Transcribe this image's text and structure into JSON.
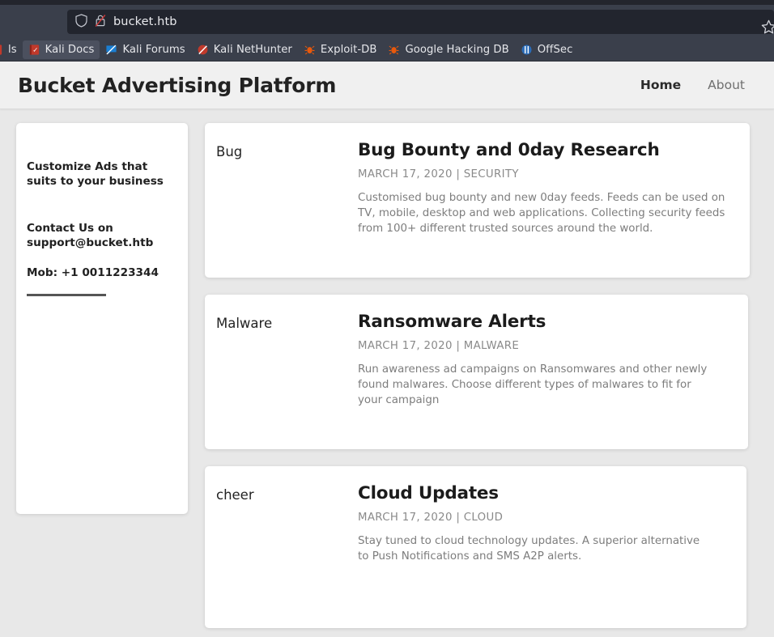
{
  "browser": {
    "url": "bucket.htb",
    "shield_icon": "shield-icon",
    "lock_icon": "lock-crossed-out-icon",
    "star_icon": "bookmark-star-icon",
    "bookmarks": [
      {
        "label": "ls",
        "icon": "kali-tools-icon",
        "active": false,
        "partial": true
      },
      {
        "label": "Kali Docs",
        "icon": "kali-docs-icon",
        "active": true
      },
      {
        "label": "Kali Forums",
        "icon": "kali-forums-icon",
        "active": false
      },
      {
        "label": "Kali NetHunter",
        "icon": "kali-nethunter-icon",
        "active": false
      },
      {
        "label": "Exploit-DB",
        "icon": "exploit-db-icon",
        "active": false
      },
      {
        "label": "Google Hacking DB",
        "icon": "google-hacking-db-icon",
        "active": false
      },
      {
        "label": "OffSec",
        "icon": "offsec-icon",
        "active": false
      }
    ]
  },
  "site": {
    "title": "Bucket Advertising Platform",
    "nav": [
      {
        "label": "Home",
        "active": true
      },
      {
        "label": "About",
        "active": false
      }
    ]
  },
  "sidebar": {
    "heading": "Customize Ads that suits to your business",
    "contact": "Contact Us on support@bucket.htb",
    "mobile": "Mob: +1 0011223344"
  },
  "posts": [
    {
      "category": "Bug",
      "title": "Bug Bounty and 0day Research",
      "meta": "MARCH 17, 2020 | SECURITY",
      "description": "Customised bug bounty and new 0day feeds. Feeds can be used on TV, mobile, desktop and web applications. Collecting security feeds from 100+ different trusted sources around the world."
    },
    {
      "category": "Malware",
      "title": "Ransomware Alerts",
      "meta": "MARCH 17, 2020 | MALWARE",
      "description": "Run awareness ad campaigns on Ransomwares and other newly found malwares. Choose different types of malwares to fit for your campaign"
    },
    {
      "category": "cheer",
      "title": "Cloud Updates",
      "meta": "MARCH 17, 2020 | CLOUD",
      "description": "Stay tuned to cloud technology updates. A superior alternative to Push Notifications and SMS A2P alerts."
    }
  ],
  "colors": {
    "chrome": "#3a3f4b",
    "urlbar": "#22252e",
    "page_bg": "#e8e8e8",
    "header_bg": "#f0f0f0",
    "card_bg": "#ffffff",
    "text_dark": "#212121",
    "text_muted": "#7d7d7d"
  }
}
